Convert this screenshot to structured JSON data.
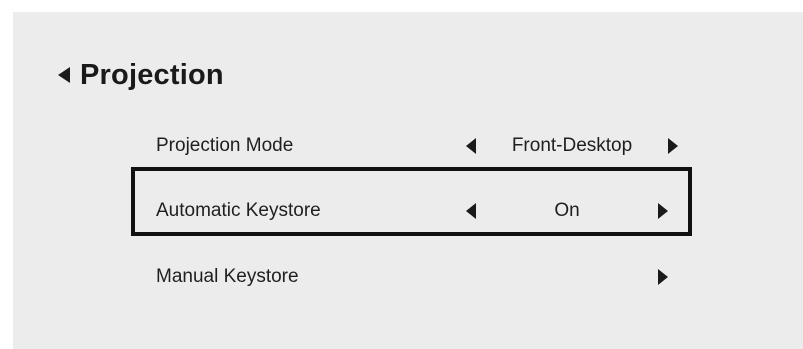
{
  "header": {
    "title": "Projection",
    "back_icon": "back-triangle-icon"
  },
  "menu": {
    "items": [
      {
        "label": "Projection Mode",
        "value": "Front-Desktop",
        "has_left_arrow": true,
        "has_right_arrow": true,
        "selected": false
      },
      {
        "label": "Automatic Keystore",
        "value": "On",
        "has_left_arrow": true,
        "has_right_arrow": true,
        "selected": true
      },
      {
        "label": "Manual Keystore",
        "value": "",
        "has_left_arrow": false,
        "has_right_arrow": true,
        "selected": false
      }
    ]
  },
  "colors": {
    "panel_bg": "#ececec",
    "text": "#1f1f1f",
    "highlight_border": "#111111"
  }
}
